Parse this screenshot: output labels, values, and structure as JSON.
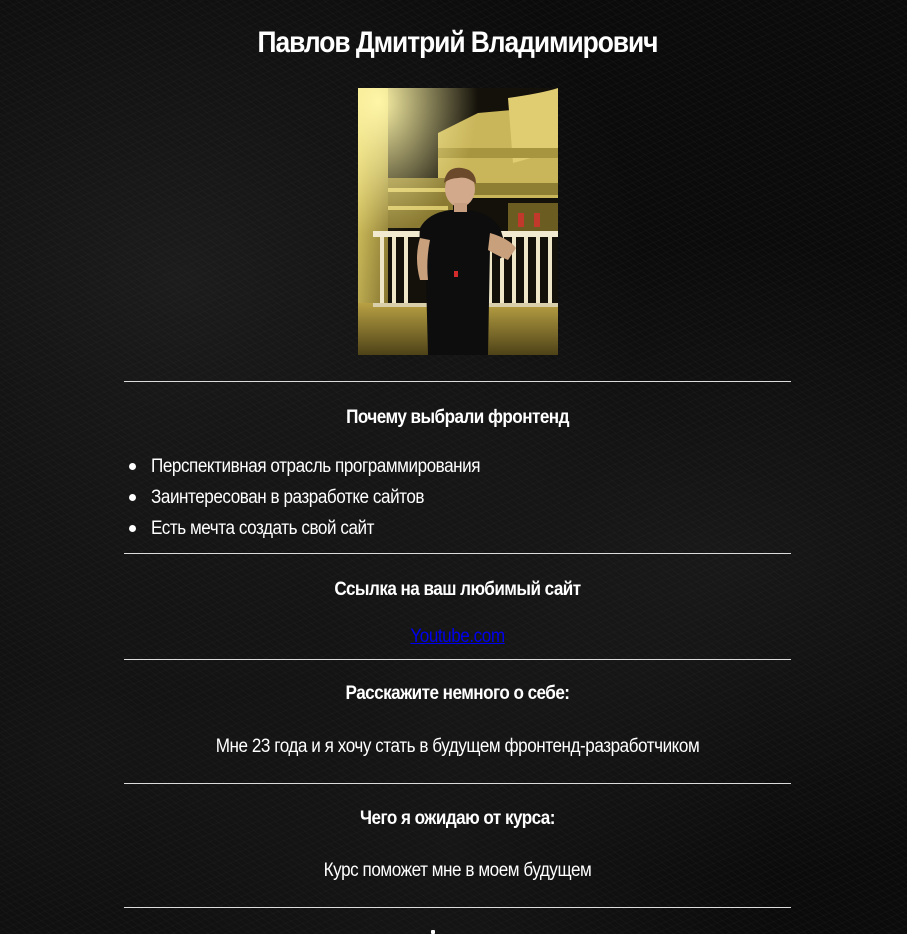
{
  "profile": {
    "name": "Павлов Дмитрий Владимирович",
    "photo_icon": "profile-photo"
  },
  "sections": {
    "why_frontend": {
      "heading": "Почему выбрали фронтенд",
      "items": [
        "Перспективная отрасль программирования",
        "Заинтересован в разработке сайтов",
        "Есть мечта создать свой сайт"
      ]
    },
    "favorite_site": {
      "heading": "Ссылка на ваш любимый сайт",
      "link_text": "Youtube.com"
    },
    "about": {
      "heading": "Расскажите немного о себе:",
      "text": "Мне 23 года и я хочу стать в будущем фронтенд-разработчиком"
    },
    "expectations": {
      "heading": "Чего я ожидаю от курса:",
      "text": "Курс поможет мне в моем будущем"
    }
  },
  "colors": {
    "background": "#0b0b0b",
    "text": "#ffffff",
    "link": "#0000ee",
    "divider": "#dcdcdc"
  }
}
